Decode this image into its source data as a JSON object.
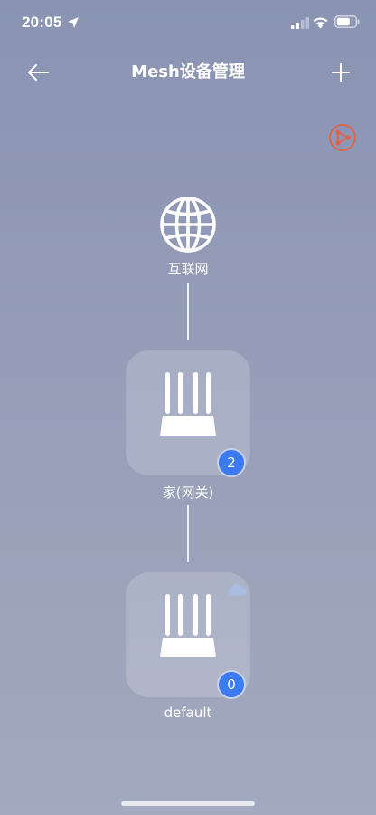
{
  "status_bar": {
    "time": "20:05",
    "icons": [
      "location-arrow-icon",
      "cellular-signal-icon",
      "wifi-icon",
      "battery-icon"
    ]
  },
  "nav": {
    "back_icon": "back-arrow-icon",
    "title": "Mesh设备管理",
    "add_icon": "plus-icon"
  },
  "topology_button": {
    "icon": "share-topology-icon",
    "color": "#e0604a"
  },
  "internet": {
    "label": "互联网",
    "icon": "globe-icon"
  },
  "routers": [
    {
      "name": "家(网关)",
      "client_count": "2",
      "icon": "router-icon"
    },
    {
      "name": "default",
      "client_count": "0",
      "icon": "router-icon",
      "status_icon": "cloud-icon"
    }
  ],
  "colors": {
    "badge": "#3b7af0",
    "background_top": "#8a93b3",
    "background_bottom": "#a3a9be"
  }
}
